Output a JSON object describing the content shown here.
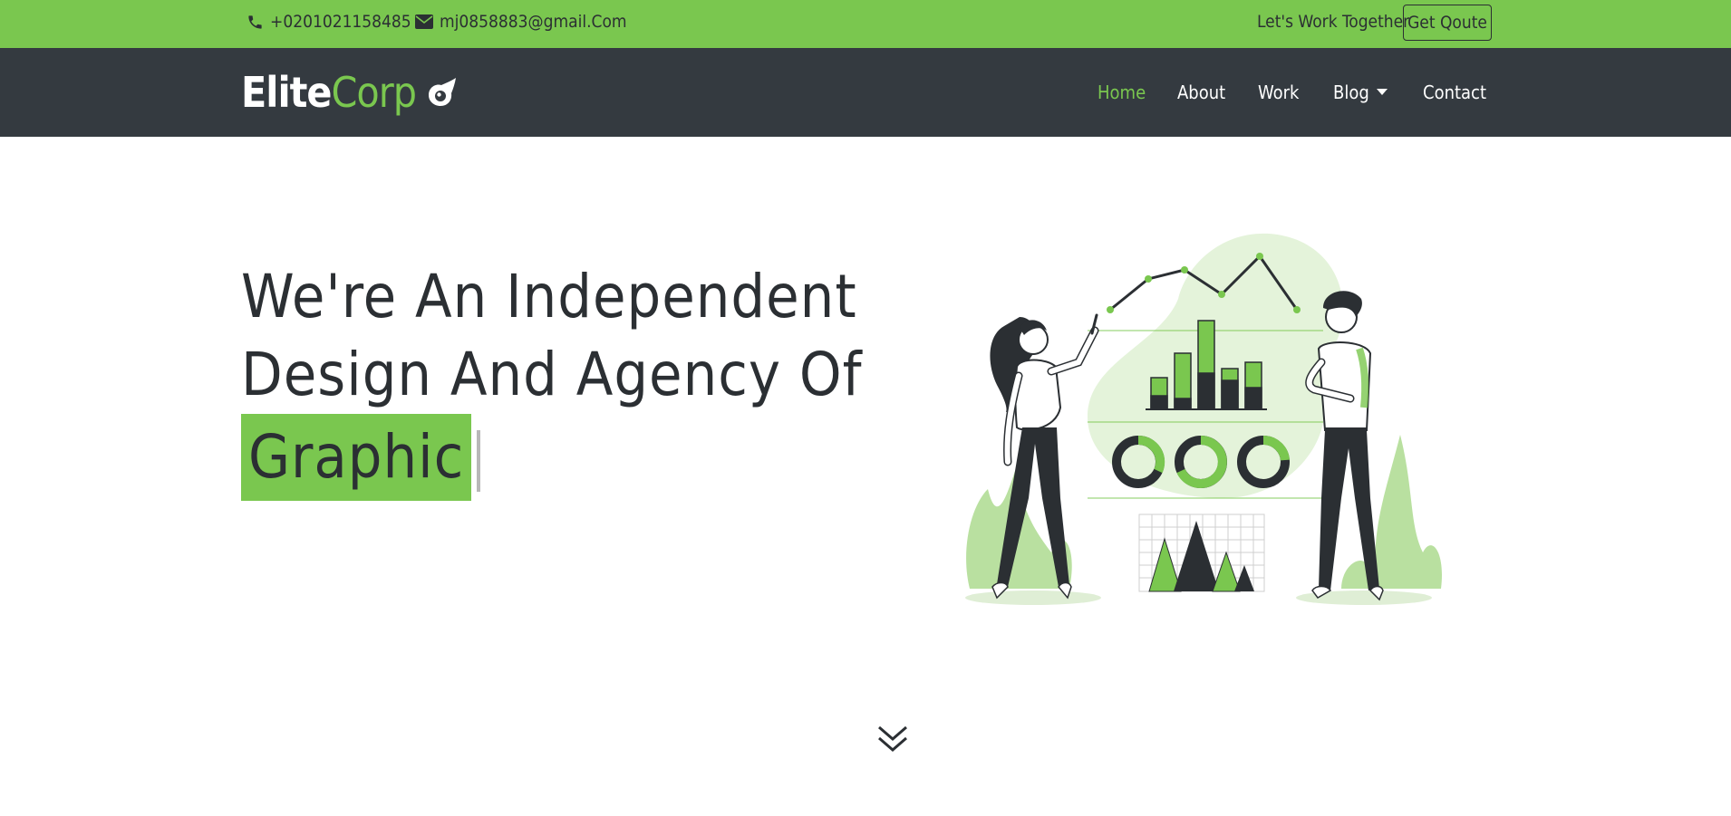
{
  "topbar": {
    "phone": "+0201021158485",
    "email": "mj0858883@gmail.Com",
    "cta_text": "Let's Work Together",
    "quote_button": "Get Qoute"
  },
  "brand": {
    "part1": "Elite",
    "part2": "Corp"
  },
  "nav": {
    "items": [
      {
        "label": "Home",
        "active": true
      },
      {
        "label": "About",
        "active": false
      },
      {
        "label": "Work",
        "active": false
      },
      {
        "label": "Blog",
        "active": false,
        "dropdown": true
      },
      {
        "label": "Contact",
        "active": false
      }
    ]
  },
  "hero": {
    "line1": "We're An Independent",
    "line2": "Design And Agency Of",
    "highlight": "Graphic"
  },
  "colors": {
    "accent": "#7ac74f",
    "dark": "#343a40",
    "text": "#2b2f33"
  },
  "icons": {
    "phone": "phone-icon",
    "email": "envelope-icon",
    "logo": "eye-comet-icon",
    "scroll": "double-chevron-down-icon"
  }
}
